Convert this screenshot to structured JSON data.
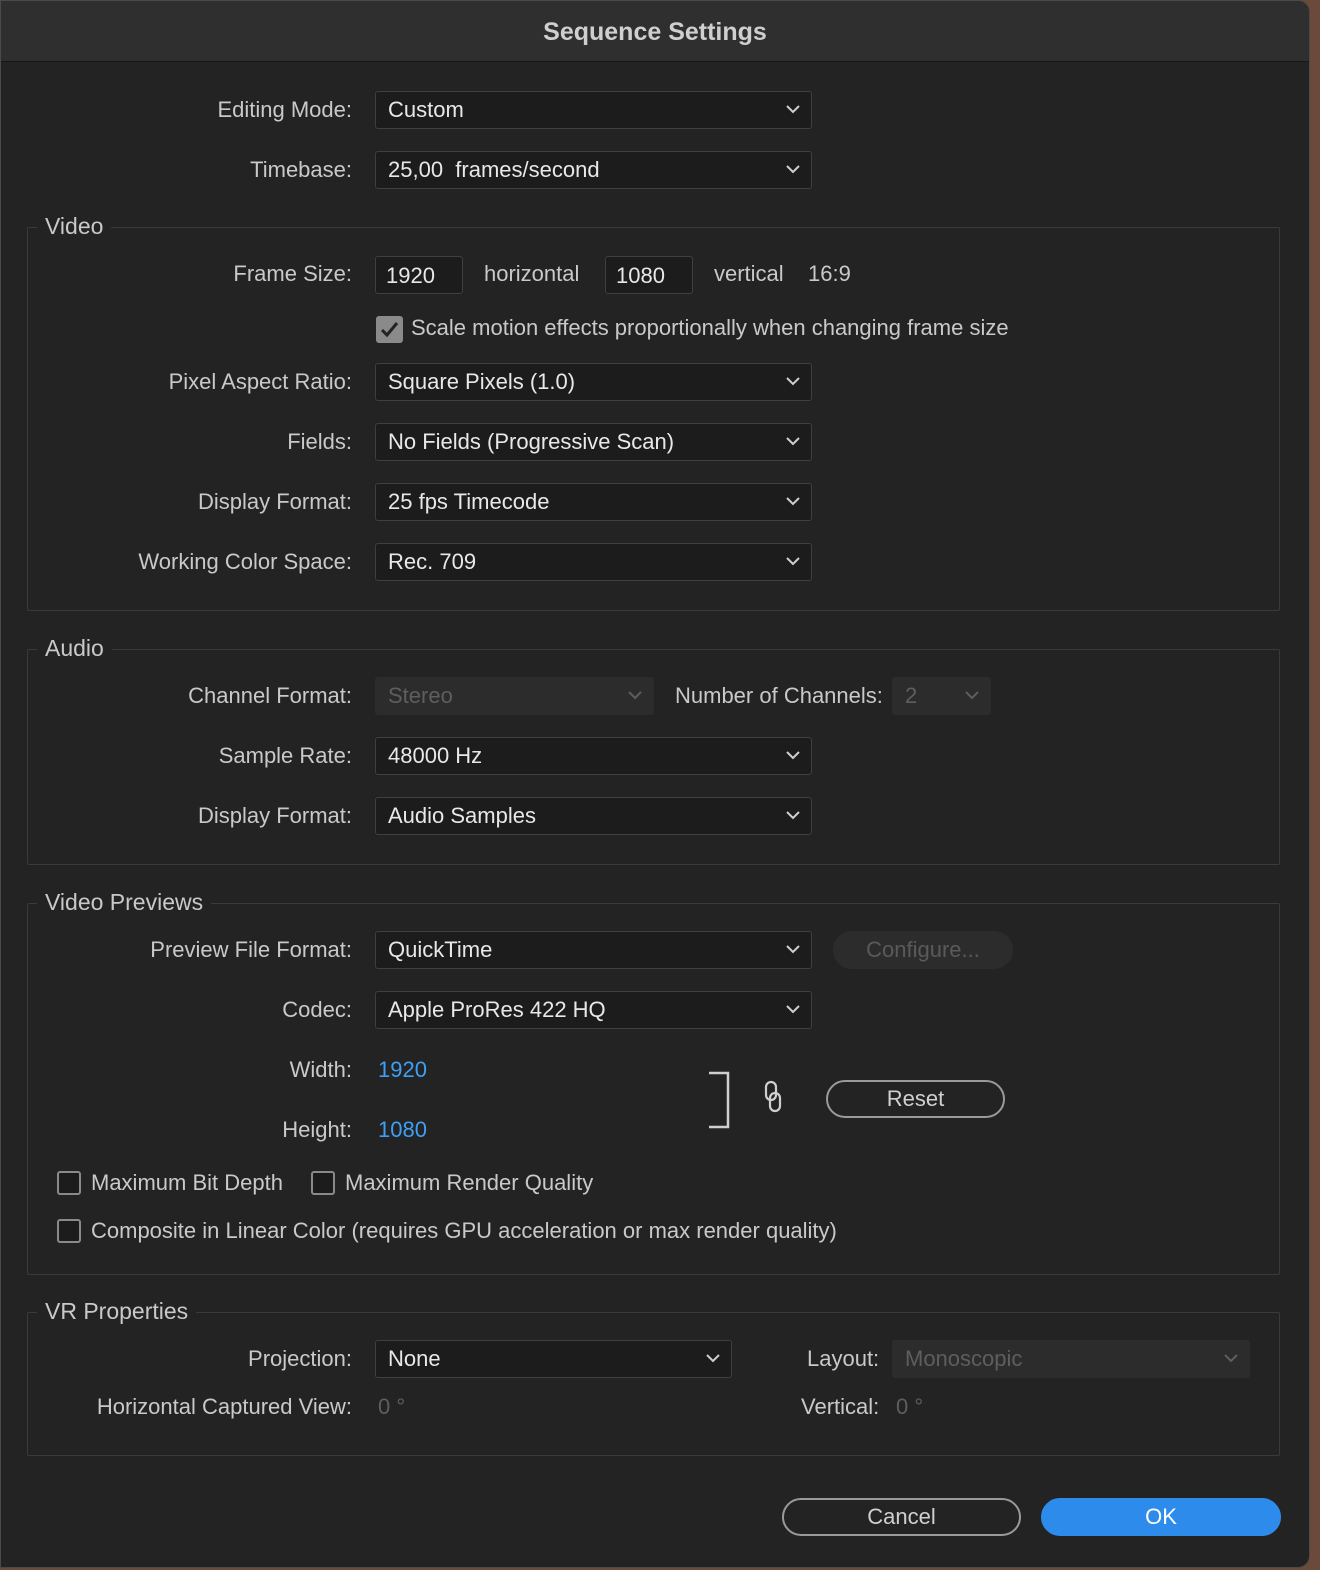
{
  "window": {
    "title": "Sequence Settings"
  },
  "general": {
    "editing_mode_label": "Editing Mode:",
    "editing_mode_value": "Custom",
    "timebase_label": "Timebase:",
    "timebase_value": "25,00  frames/second"
  },
  "video": {
    "section_title": "Video",
    "frame_size_label": "Frame Size:",
    "frame_width": "1920",
    "horizontal_label": "horizontal",
    "frame_height": "1080",
    "vertical_label": "vertical",
    "aspect": "16:9",
    "scale_motion_label": "Scale motion effects proportionally when changing frame size",
    "scale_motion_checked": true,
    "pixel_aspect_label": "Pixel Aspect Ratio:",
    "pixel_aspect_value": "Square Pixels (1.0)",
    "fields_label": "Fields:",
    "fields_value": "No Fields (Progressive Scan)",
    "display_format_label": "Display Format:",
    "display_format_value": "25 fps Timecode",
    "color_space_label": "Working Color Space:",
    "color_space_value": "Rec. 709"
  },
  "audio": {
    "section_title": "Audio",
    "channel_format_label": "Channel Format:",
    "channel_format_value": "Stereo",
    "num_channels_label": "Number of Channels:",
    "num_channels_value": "2",
    "sample_rate_label": "Sample Rate:",
    "sample_rate_value": "48000 Hz",
    "display_format_label": "Display Format:",
    "display_format_value": "Audio Samples"
  },
  "previews": {
    "section_title": "Video Previews",
    "file_format_label": "Preview File Format:",
    "file_format_value": "QuickTime",
    "configure_label": "Configure...",
    "codec_label": "Codec:",
    "codec_value": "Apple ProRes 422 HQ",
    "width_label": "Width:",
    "width_value": "1920",
    "height_label": "Height:",
    "height_value": "1080",
    "reset_label": "Reset",
    "max_bit_depth_label": "Maximum Bit Depth",
    "max_render_quality_label": "Maximum Render Quality",
    "linear_color_label": "Composite in Linear Color (requires GPU acceleration or max render quality)"
  },
  "vr": {
    "section_title": "VR Properties",
    "projection_label": "Projection:",
    "projection_value": "None",
    "layout_label": "Layout:",
    "layout_value": "Monoscopic",
    "h_view_label": "Horizontal Captured View:",
    "h_view_value": "0 °",
    "vertical_label": "Vertical:",
    "vertical_value": "0 °"
  },
  "footer": {
    "cancel_label": "Cancel",
    "ok_label": "OK"
  },
  "colors": {
    "accent": "#2d8ceb",
    "link_value": "#3d9ff5",
    "background": "#232323"
  }
}
